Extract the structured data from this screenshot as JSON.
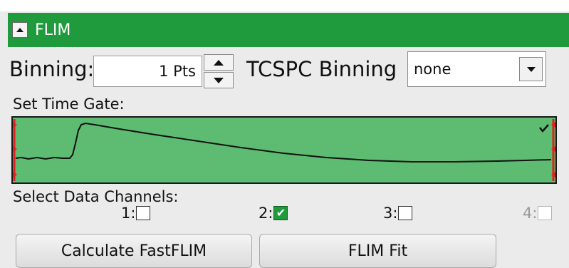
{
  "panel": {
    "title": "FLIM",
    "collapsed": false
  },
  "binning": {
    "label": "Binning:",
    "value": "1 Pts"
  },
  "tcspc": {
    "label": "TCSPC Binning",
    "selected": "none"
  },
  "time_gate": {
    "label": "Set Time Gate:"
  },
  "channels": {
    "label": "Select Data Channels:",
    "items": [
      {
        "label": "1:",
        "checked": false,
        "enabled": true
      },
      {
        "label": "2:",
        "checked": true,
        "enabled": true
      },
      {
        "label": "3:",
        "checked": false,
        "enabled": true
      },
      {
        "label": "4:",
        "checked": false,
        "enabled": false
      }
    ]
  },
  "buttons": {
    "calculate": "Calculate FastFLIM",
    "fit": "FLIM Fit"
  },
  "colors": {
    "header": "#1f9a3c",
    "plot_bg": "#5dbb72",
    "gate_marker": "#e02020"
  },
  "icons": {
    "collapse": "triangle-up-icon",
    "stepper_up": "triangle-up-icon",
    "stepper_down": "triangle-down-icon",
    "dropdown": "chevron-down-icon",
    "plot_check": "check-icon"
  }
}
